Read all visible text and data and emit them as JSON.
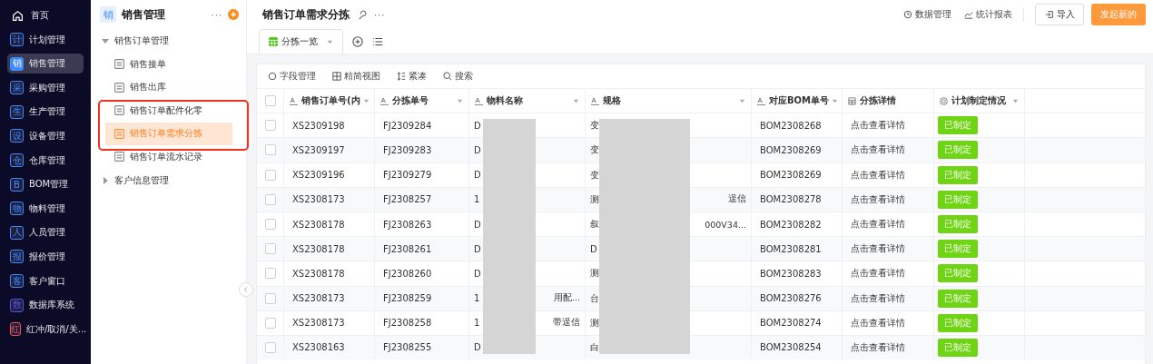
{
  "nav": [
    {
      "label": "首页",
      "selected": false
    },
    {
      "glyph": "计",
      "label": "计划管理",
      "selected": false,
      "color": "#3d8bff"
    },
    {
      "glyph": "销",
      "label": "销售管理",
      "selected": true,
      "color": "#3d8bff"
    },
    {
      "glyph": "采",
      "label": "采购管理",
      "selected": false,
      "color": "#3d8bff"
    },
    {
      "glyph": "生",
      "label": "生产管理",
      "selected": false,
      "color": "#3d8bff"
    },
    {
      "glyph": "设",
      "label": "设备管理",
      "selected": false,
      "color": "#3d8bff"
    },
    {
      "glyph": "仓",
      "label": "仓库管理",
      "selected": false,
      "color": "#3d8bff"
    },
    {
      "glyph": "B",
      "label": "BOM管理",
      "selected": false,
      "color": "#3d8bff"
    },
    {
      "glyph": "物",
      "label": "物料管理",
      "selected": false,
      "color": "#3d8bff"
    },
    {
      "glyph": "人",
      "label": "人员管理",
      "selected": false,
      "color": "#3d8bff"
    },
    {
      "glyph": "报",
      "label": "报价管理",
      "selected": false,
      "color": "#3d8bff"
    },
    {
      "glyph": "客",
      "label": "客户窗口",
      "selected": false,
      "color": "#3d8bff"
    },
    {
      "glyph": "数",
      "label": "数据库系统",
      "selected": false,
      "color": "#5a4fe0"
    },
    {
      "glyph": "红",
      "label": "红冲/取消/关...",
      "selected": false,
      "color": "#ff4d4f"
    }
  ],
  "app": {
    "glyph": "销",
    "title": "销售管理",
    "more": "···"
  },
  "tree": [
    {
      "label": "销售订单管理",
      "expanded": true,
      "children": [
        {
          "label": "销售接单",
          "selected": false
        },
        {
          "label": "销售出库",
          "selected": false
        },
        {
          "label": "销售订单配件化零",
          "selected": false
        },
        {
          "label": "销售订单需求分拣",
          "selected": true
        },
        {
          "label": "销售订单流水记录",
          "selected": false
        }
      ]
    },
    {
      "label": "客户信息管理",
      "expanded": false
    }
  ],
  "page": {
    "title": "销售订单需求分拣",
    "more": "···",
    "links": [
      "数据管理",
      "统计报表"
    ],
    "import": "导入",
    "create": "发起新的"
  },
  "views": [
    {
      "label": "分拣一览",
      "selected": true
    }
  ],
  "toolbar": [
    "字段管理",
    "精简视图",
    "紧凑",
    "搜索"
  ],
  "select_all": false,
  "columns": [
    "销售订单号(内",
    "分拣单号",
    "物料名称",
    "规格",
    "对应BOM单号",
    "分拣详情",
    "计划制定情况"
  ],
  "rows": [
    {
      "order": "XS2309198",
      "sort": "FJ2309284",
      "material": "D",
      "spec": "变",
      "bom": "BOM2308268",
      "detail": "点击查看详情",
      "status": "已制定",
      "checked": false
    },
    {
      "order": "XS2309197",
      "sort": "FJ2309283",
      "material": "D",
      "spec": "变",
      "bom": "BOM2308269",
      "detail": "点击查看详情",
      "status": "已制定",
      "checked": false
    },
    {
      "order": "XS2309196",
      "sort": "FJ2309279",
      "material": "D",
      "spec": "变",
      "bom": "BOM2308269",
      "detail": "点击查看详情",
      "status": "已制定",
      "checked": false
    },
    {
      "order": "XS2308173",
      "sort": "FJ2308257",
      "material": "1",
      "spec": "测",
      "spec_tail": "逞信",
      "bom": "BOM2308278",
      "detail": "点击查看详情",
      "status": "已制定",
      "checked": false
    },
    {
      "order": "XS2308178",
      "sort": "FJ2308263",
      "material": "D",
      "spec": "叙",
      "spec_tail": "000V34...",
      "bom": "BOM2308282",
      "detail": "点击查看详情",
      "status": "已制定",
      "checked": false
    },
    {
      "order": "XS2308178",
      "sort": "FJ2308261",
      "material": "D",
      "spec": "D",
      "bom": "BOM2308281",
      "detail": "点击查看详情",
      "status": "已制定",
      "checked": false
    },
    {
      "order": "XS2308178",
      "sort": "FJ2308260",
      "material": "D",
      "spec": "测",
      "bom": "BOM2308283",
      "detail": "点击查看详情",
      "status": "已制定",
      "checked": false
    },
    {
      "order": "XS2308173",
      "sort": "FJ2308259",
      "material": "1",
      "material_tail": "用配...",
      "spec": "台",
      "bom": "BOM2308276",
      "detail": "点击查看详情",
      "status": "已制定",
      "checked": false
    },
    {
      "order": "XS2308173",
      "sort": "FJ2308258",
      "material": "1",
      "material_tail": "带逞信",
      "spec": "测",
      "bom": "BOM2308274",
      "detail": "点击查看详情",
      "status": "已制定",
      "checked": false
    },
    {
      "order": "XS2308163",
      "sort": "FJ2308255",
      "material": "D",
      "spec": "白",
      "bom": "BOM2308254",
      "detail": "点击查看详情",
      "status": "已制定",
      "checked": false
    }
  ]
}
